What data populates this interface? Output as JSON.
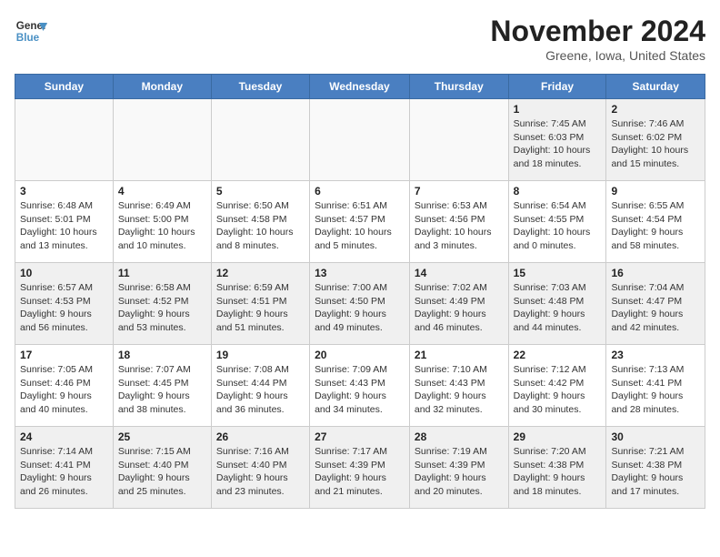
{
  "header": {
    "logo_line1": "General",
    "logo_line2": "Blue",
    "month_year": "November 2024",
    "location": "Greene, Iowa, United States"
  },
  "weekdays": [
    "Sunday",
    "Monday",
    "Tuesday",
    "Wednesday",
    "Thursday",
    "Friday",
    "Saturday"
  ],
  "weeks": [
    [
      {
        "day": "",
        "info": ""
      },
      {
        "day": "",
        "info": ""
      },
      {
        "day": "",
        "info": ""
      },
      {
        "day": "",
        "info": ""
      },
      {
        "day": "",
        "info": ""
      },
      {
        "day": "1",
        "info": "Sunrise: 7:45 AM\nSunset: 6:03 PM\nDaylight: 10 hours\nand 18 minutes."
      },
      {
        "day": "2",
        "info": "Sunrise: 7:46 AM\nSunset: 6:02 PM\nDaylight: 10 hours\nand 15 minutes."
      }
    ],
    [
      {
        "day": "3",
        "info": "Sunrise: 6:48 AM\nSunset: 5:01 PM\nDaylight: 10 hours\nand 13 minutes."
      },
      {
        "day": "4",
        "info": "Sunrise: 6:49 AM\nSunset: 5:00 PM\nDaylight: 10 hours\nand 10 minutes."
      },
      {
        "day": "5",
        "info": "Sunrise: 6:50 AM\nSunset: 4:58 PM\nDaylight: 10 hours\nand 8 minutes."
      },
      {
        "day": "6",
        "info": "Sunrise: 6:51 AM\nSunset: 4:57 PM\nDaylight: 10 hours\nand 5 minutes."
      },
      {
        "day": "7",
        "info": "Sunrise: 6:53 AM\nSunset: 4:56 PM\nDaylight: 10 hours\nand 3 minutes."
      },
      {
        "day": "8",
        "info": "Sunrise: 6:54 AM\nSunset: 4:55 PM\nDaylight: 10 hours\nand 0 minutes."
      },
      {
        "day": "9",
        "info": "Sunrise: 6:55 AM\nSunset: 4:54 PM\nDaylight: 9 hours\nand 58 minutes."
      }
    ],
    [
      {
        "day": "10",
        "info": "Sunrise: 6:57 AM\nSunset: 4:53 PM\nDaylight: 9 hours\nand 56 minutes."
      },
      {
        "day": "11",
        "info": "Sunrise: 6:58 AM\nSunset: 4:52 PM\nDaylight: 9 hours\nand 53 minutes."
      },
      {
        "day": "12",
        "info": "Sunrise: 6:59 AM\nSunset: 4:51 PM\nDaylight: 9 hours\nand 51 minutes."
      },
      {
        "day": "13",
        "info": "Sunrise: 7:00 AM\nSunset: 4:50 PM\nDaylight: 9 hours\nand 49 minutes."
      },
      {
        "day": "14",
        "info": "Sunrise: 7:02 AM\nSunset: 4:49 PM\nDaylight: 9 hours\nand 46 minutes."
      },
      {
        "day": "15",
        "info": "Sunrise: 7:03 AM\nSunset: 4:48 PM\nDaylight: 9 hours\nand 44 minutes."
      },
      {
        "day": "16",
        "info": "Sunrise: 7:04 AM\nSunset: 4:47 PM\nDaylight: 9 hours\nand 42 minutes."
      }
    ],
    [
      {
        "day": "17",
        "info": "Sunrise: 7:05 AM\nSunset: 4:46 PM\nDaylight: 9 hours\nand 40 minutes."
      },
      {
        "day": "18",
        "info": "Sunrise: 7:07 AM\nSunset: 4:45 PM\nDaylight: 9 hours\nand 38 minutes."
      },
      {
        "day": "19",
        "info": "Sunrise: 7:08 AM\nSunset: 4:44 PM\nDaylight: 9 hours\nand 36 minutes."
      },
      {
        "day": "20",
        "info": "Sunrise: 7:09 AM\nSunset: 4:43 PM\nDaylight: 9 hours\nand 34 minutes."
      },
      {
        "day": "21",
        "info": "Sunrise: 7:10 AM\nSunset: 4:43 PM\nDaylight: 9 hours\nand 32 minutes."
      },
      {
        "day": "22",
        "info": "Sunrise: 7:12 AM\nSunset: 4:42 PM\nDaylight: 9 hours\nand 30 minutes."
      },
      {
        "day": "23",
        "info": "Sunrise: 7:13 AM\nSunset: 4:41 PM\nDaylight: 9 hours\nand 28 minutes."
      }
    ],
    [
      {
        "day": "24",
        "info": "Sunrise: 7:14 AM\nSunset: 4:41 PM\nDaylight: 9 hours\nand 26 minutes."
      },
      {
        "day": "25",
        "info": "Sunrise: 7:15 AM\nSunset: 4:40 PM\nDaylight: 9 hours\nand 25 minutes."
      },
      {
        "day": "26",
        "info": "Sunrise: 7:16 AM\nSunset: 4:40 PM\nDaylight: 9 hours\nand 23 minutes."
      },
      {
        "day": "27",
        "info": "Sunrise: 7:17 AM\nSunset: 4:39 PM\nDaylight: 9 hours\nand 21 minutes."
      },
      {
        "day": "28",
        "info": "Sunrise: 7:19 AM\nSunset: 4:39 PM\nDaylight: 9 hours\nand 20 minutes."
      },
      {
        "day": "29",
        "info": "Sunrise: 7:20 AM\nSunset: 4:38 PM\nDaylight: 9 hours\nand 18 minutes."
      },
      {
        "day": "30",
        "info": "Sunrise: 7:21 AM\nSunset: 4:38 PM\nDaylight: 9 hours\nand 17 minutes."
      }
    ]
  ]
}
